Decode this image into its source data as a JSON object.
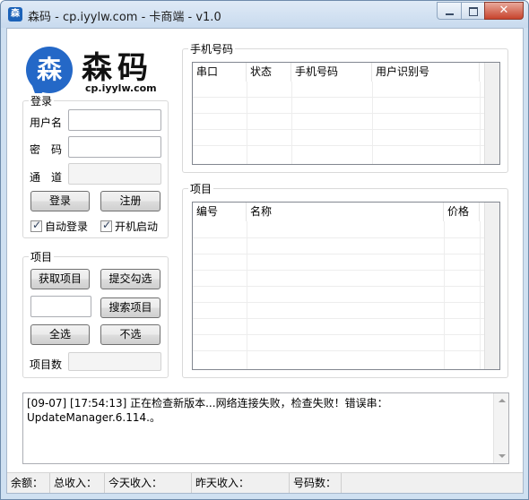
{
  "window": {
    "title": "森码 - cp.iyylw.com - 卡商端 - v1.0",
    "icon_glyph": "森",
    "close_glyph": "✕"
  },
  "logo": {
    "glyph": "森",
    "name": "森码",
    "url": "cp.iyylw.com"
  },
  "login": {
    "title": "登录",
    "username_label": "用户名",
    "username_value": "",
    "password_label": "密　码",
    "password_value": "",
    "channel_label": "通　道",
    "channel_value": "",
    "login_button": "登录",
    "register_button": "注册",
    "auto_login_label": "自动登录",
    "auto_login_checked": true,
    "startup_label": "开机启动",
    "startup_checked": true
  },
  "project": {
    "title": "项目",
    "get_projects_button": "获取项目",
    "submit_checked_button": "提交勾选",
    "search_value": "",
    "search_button": "搜索项目",
    "select_all_button": "全选",
    "select_none_button": "不选",
    "count_label": "项目数",
    "count_value": ""
  },
  "phone_panel": {
    "title": "手机号码",
    "columns": [
      "串口",
      "状态",
      "手机号码",
      "用户识别号"
    ]
  },
  "project_panel": {
    "title": "项目",
    "columns": [
      "编号",
      "名称",
      "价格"
    ]
  },
  "log": {
    "text": "[09-07] [17:54:13] 正在检查新版本...网络连接失败，检查失败！错误串：UpdateManager.6.114.。"
  },
  "status": {
    "balance_label": "余额：",
    "total_income_label": "总收入：",
    "today_income_label": "今天收入：",
    "yesterday_income_label": "昨天收入：",
    "number_count_label": "号码数："
  },
  "colors": {
    "accent": "#2468c7",
    "titlebar": "#cfe0f1",
    "close_button": "#c7432c"
  }
}
